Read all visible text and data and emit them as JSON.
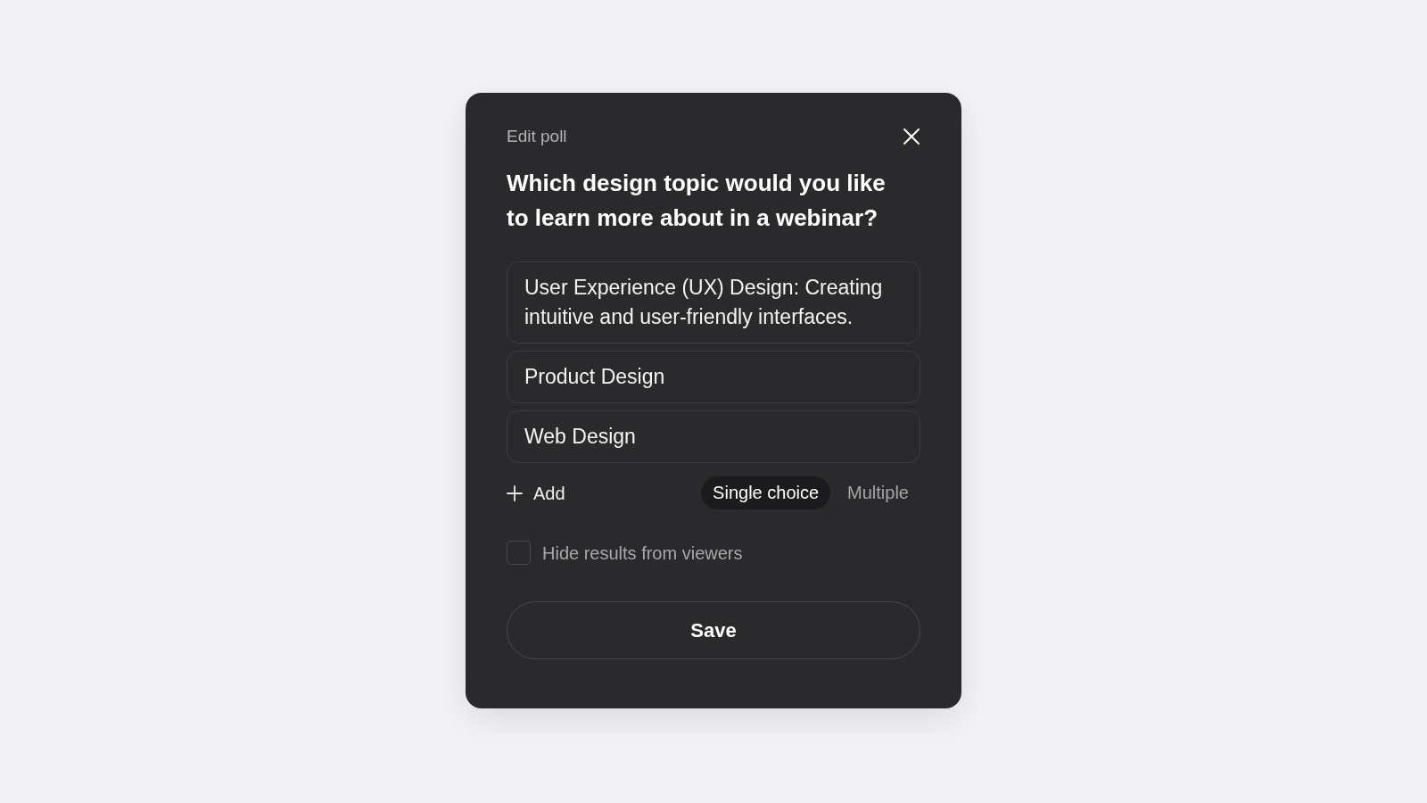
{
  "dialog": {
    "title": "Edit poll",
    "question": "Which design topic would you like to learn more about in a webinar?",
    "options": [
      {
        "value": "User Experience (UX) Design: Creating intuitive and user-friendly interfaces."
      },
      {
        "value": "Product Design"
      },
      {
        "value": "Web Design"
      }
    ],
    "add_button": "Add",
    "choice_modes": [
      {
        "label": "Single choice",
        "selected": true
      },
      {
        "label": "Multiple",
        "selected": false
      }
    ],
    "hide_results": {
      "label": "Hide results from viewers",
      "checked": false
    },
    "save_button": "Save"
  }
}
